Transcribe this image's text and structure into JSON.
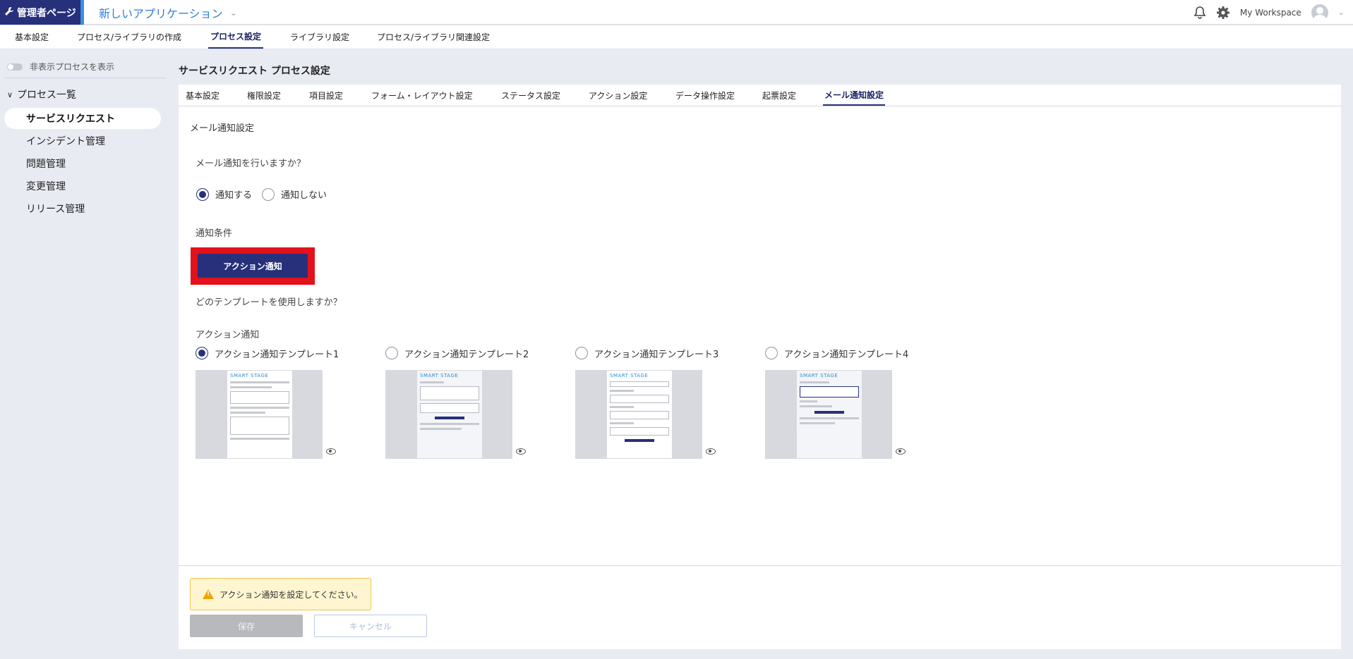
{
  "header": {
    "admin_label": "管理者ページ",
    "app_name": "新しいアプリケーション",
    "workspace": "My Workspace"
  },
  "main_nav": {
    "tabs": [
      "基本設定",
      "プロセス/ライブラリの作成",
      "プロセス設定",
      "ライブラリ設定",
      "プロセス/ライブラリ関連設定"
    ],
    "active": "プロセス設定"
  },
  "sidebar": {
    "toggle_label": "非表示プロセスを表示",
    "section_title": "プロセス一覧",
    "items": [
      "サービスリクエスト",
      "インシデント管理",
      "問題管理",
      "変更管理",
      "リリース管理"
    ],
    "active": "サービスリクエスト"
  },
  "page": {
    "title": "サービスリクエスト プロセス設定"
  },
  "sub_tabs": {
    "tabs": [
      "基本設定",
      "権限設定",
      "項目設定",
      "フォーム・レイアウト設定",
      "ステータス設定",
      "アクション設定",
      "データ操作設定",
      "起票設定",
      "メール通知設定"
    ],
    "active": "メール通知設定"
  },
  "mail": {
    "section_title": "メール通知設定",
    "question_notify": "メール通知を行いますか？",
    "options": [
      "通知する",
      "通知しない"
    ],
    "selected": "通知する",
    "condition_label": "通知条件",
    "action_button": "アクション通知",
    "question_template": "どのテンプレートを使用しますか？",
    "template_group_label": "アクション通知",
    "templates": [
      "アクション通知テンプレート1",
      "アクション通知テンプレート2",
      "アクション通知テンプレート3",
      "アクション通知テンプレート4"
    ],
    "selected_template": "アクション通知テンプレート1",
    "thumb_brand": "SMART STAGE"
  },
  "footer": {
    "warning": "アクション通知を設定してください。",
    "save": "保存",
    "cancel": "キャンセル"
  },
  "colors": {
    "navy": "#27307a",
    "accent_blue": "#2f7fd8",
    "highlight_red": "#e3111b",
    "warning_bg": "#fff6d1"
  }
}
